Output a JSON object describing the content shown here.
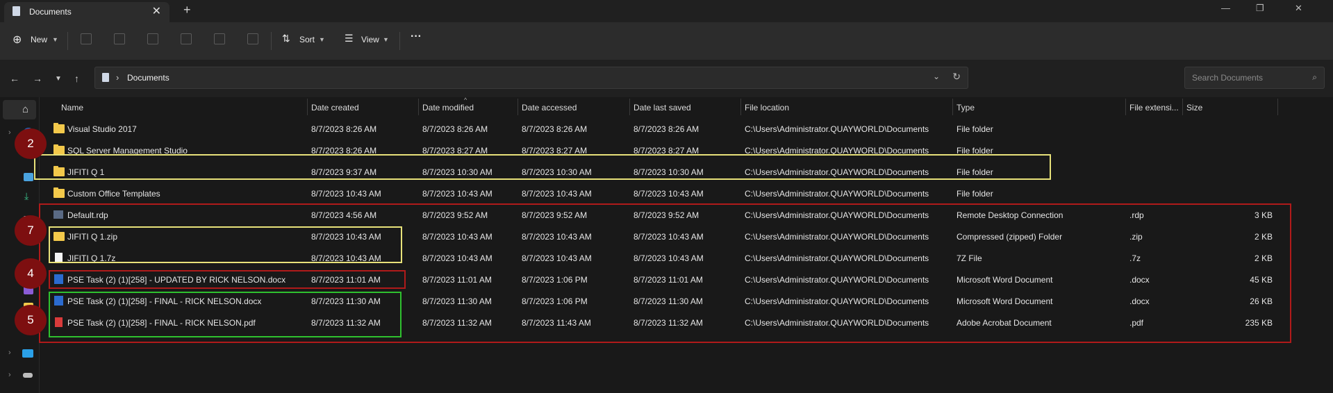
{
  "window": {
    "tab_title": "Documents",
    "tab_close": "✕",
    "new_tab": "+",
    "minimize": "—",
    "maximize": "❐",
    "close": "✕"
  },
  "toolbar": {
    "new_label": "New",
    "sort_label": "Sort",
    "view_label": "View",
    "more_label": "···"
  },
  "address": {
    "chevron": "›",
    "location": "Documents",
    "search_placeholder": "Search Documents"
  },
  "columns": {
    "name": "Name",
    "date_created": "Date created",
    "date_modified": "Date modified",
    "date_accessed": "Date accessed",
    "date_last_saved": "Date last saved",
    "file_location": "File location",
    "type": "Type",
    "extension": "File extensi...",
    "size": "Size"
  },
  "files": [
    {
      "name": "Visual Studio 2017",
      "icon": "folder-icon",
      "created": "8/7/2023 8:26 AM",
      "modified": "8/7/2023 8:26 AM",
      "accessed": "8/7/2023 8:26 AM",
      "saved": "8/7/2023 8:26 AM",
      "location": "C:\\Users\\Administrator.QUAYWORLD\\Documents",
      "type": "File folder",
      "ext": "",
      "size": ""
    },
    {
      "name": "SQL Server Management Studio",
      "icon": "folder-icon",
      "created": "8/7/2023 8:26 AM",
      "modified": "8/7/2023 8:27 AM",
      "accessed": "8/7/2023 8:27 AM",
      "saved": "8/7/2023 8:27 AM",
      "location": "C:\\Users\\Administrator.QUAYWORLD\\Documents",
      "type": "File folder",
      "ext": "",
      "size": ""
    },
    {
      "name": "JIFITI Q 1",
      "icon": "folder-icon",
      "created": "8/7/2023 9:37 AM",
      "modified": "8/7/2023 10:30 AM",
      "accessed": "8/7/2023 10:30 AM",
      "saved": "8/7/2023 10:30 AM",
      "location": "C:\\Users\\Administrator.QUAYWORLD\\Documents",
      "type": "File folder",
      "ext": "",
      "size": ""
    },
    {
      "name": "Custom Office Templates",
      "icon": "folder-icon",
      "created": "8/7/2023 10:43 AM",
      "modified": "8/7/2023 10:43 AM",
      "accessed": "8/7/2023 10:43 AM",
      "saved": "8/7/2023 10:43 AM",
      "location": "C:\\Users\\Administrator.QUAYWORLD\\Documents",
      "type": "File folder",
      "ext": "",
      "size": ""
    },
    {
      "name": "Default.rdp",
      "icon": "rdp-icon",
      "created": "8/7/2023 4:56 AM",
      "modified": "8/7/2023 9:52 AM",
      "accessed": "8/7/2023 9:52 AM",
      "saved": "8/7/2023 9:52 AM",
      "location": "C:\\Users\\Administrator.QUAYWORLD\\Documents",
      "type": "Remote Desktop Connection",
      "ext": ".rdp",
      "size": "3 KB"
    },
    {
      "name": "JIFITI Q 1.zip",
      "icon": "zip-icon",
      "created": "8/7/2023 10:43 AM",
      "modified": "8/7/2023 10:43 AM",
      "accessed": "8/7/2023 10:43 AM",
      "saved": "8/7/2023 10:43 AM",
      "location": "C:\\Users\\Administrator.QUAYWORLD\\Documents",
      "type": "Compressed (zipped) Folder",
      "ext": ".zip",
      "size": "2 KB"
    },
    {
      "name": "JIFITI Q 1.7z",
      "icon": "file-icon",
      "created": "8/7/2023 10:43 AM",
      "modified": "8/7/2023 10:43 AM",
      "accessed": "8/7/2023 10:43 AM",
      "saved": "8/7/2023 10:43 AM",
      "location": "C:\\Users\\Administrator.QUAYWORLD\\Documents",
      "type": "7Z File",
      "ext": ".7z",
      "size": "2 KB"
    },
    {
      "name": "PSE Task (2) (1)[258] - UPDATED BY RICK NELSON.docx",
      "icon": "word-icon",
      "created": "8/7/2023 11:01 AM",
      "modified": "8/7/2023 11:01 AM",
      "accessed": "8/7/2023 1:06 PM",
      "saved": "8/7/2023 11:01 AM",
      "location": "C:\\Users\\Administrator.QUAYWORLD\\Documents",
      "type": "Microsoft Word Document",
      "ext": ".docx",
      "size": "45 KB"
    },
    {
      "name": "PSE Task (2) (1)[258] - FINAL - RICK NELSON.docx",
      "icon": "word-icon",
      "created": "8/7/2023 11:30 AM",
      "modified": "8/7/2023 11:30 AM",
      "accessed": "8/7/2023 1:06 PM",
      "saved": "8/7/2023 11:30 AM",
      "location": "C:\\Users\\Administrator.QUAYWORLD\\Documents",
      "type": "Microsoft Word Document",
      "ext": ".docx",
      "size": "26 KB"
    },
    {
      "name": "PSE Task (2) (1)[258] - FINAL - RICK NELSON.pdf",
      "icon": "pdf-icon",
      "created": "8/7/2023 11:32 AM",
      "modified": "8/7/2023 11:32 AM",
      "accessed": "8/7/2023 11:43 AM",
      "saved": "8/7/2023 11:32 AM",
      "location": "C:\\Users\\Administrator.QUAYWORLD\\Documents",
      "type": "Adobe Acrobat Document",
      "ext": ".pdf",
      "size": "235 KB"
    }
  ],
  "annotations": {
    "badge_2": "2",
    "badge_7": "7",
    "badge_4": "4",
    "badge_5": "5",
    "colors": {
      "yellow": "#e8e27a",
      "red": "#b01a1a",
      "green": "#2fc12f",
      "badge": "#7d0f10"
    }
  }
}
